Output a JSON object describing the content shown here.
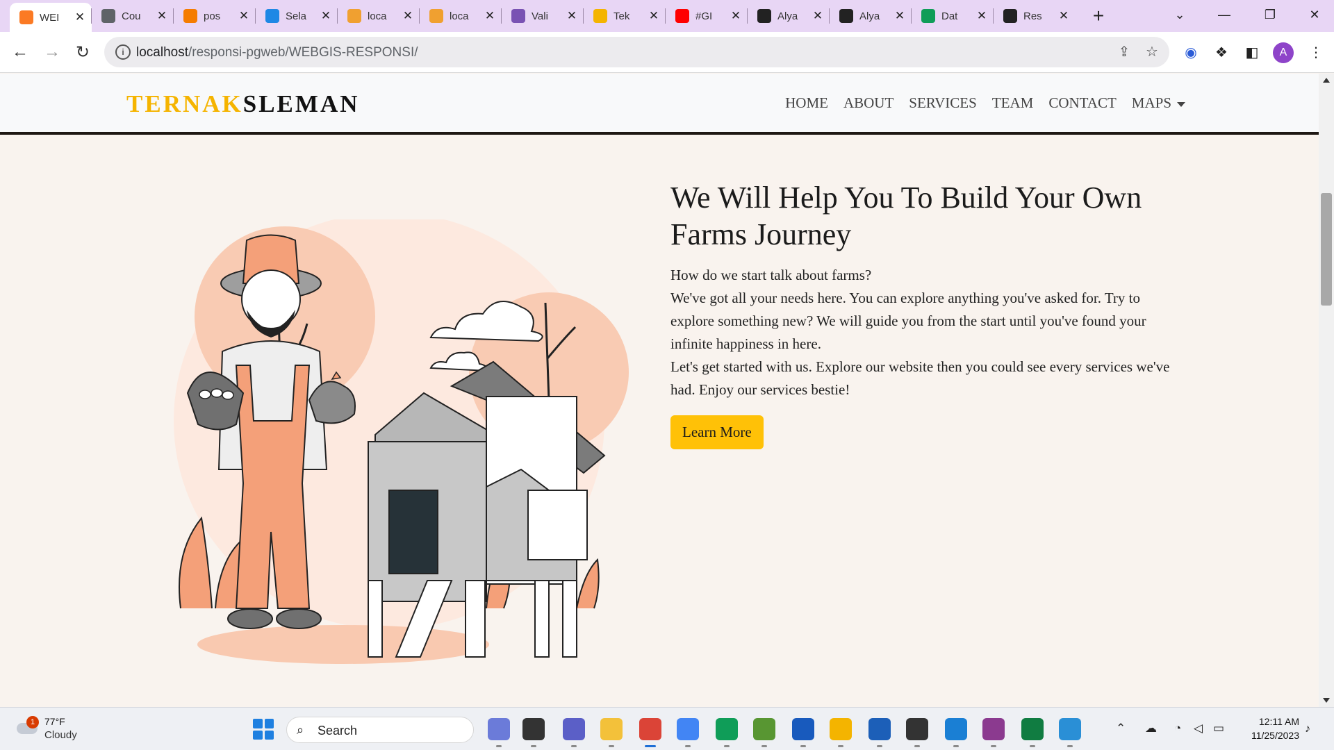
{
  "browser": {
    "tabs": [
      {
        "title": "WEI",
        "icon": "xampp-icon",
        "color": "#fb7a24"
      },
      {
        "title": "Cou",
        "icon": "globe-icon",
        "color": "#5f6368"
      },
      {
        "title": "pos",
        "icon": "postgis-icon",
        "color": "#f57c00"
      },
      {
        "title": "Sela",
        "icon": "snowflake-icon",
        "color": "#1e88e5"
      },
      {
        "title": "loca",
        "icon": "phpmyadmin-icon",
        "color": "#f0a030"
      },
      {
        "title": "loca",
        "icon": "phpmyadmin-icon",
        "color": "#f0a030"
      },
      {
        "title": "Vali",
        "icon": "bootstrap-icon",
        "color": "#7952b3"
      },
      {
        "title": "Tek",
        "icon": "slides-icon",
        "color": "#f4b400"
      },
      {
        "title": "#GI",
        "icon": "youtube-icon",
        "color": "#ff0000"
      },
      {
        "title": "Alya",
        "icon": "github-icon",
        "color": "#222222"
      },
      {
        "title": "Alya",
        "icon": "github-icon",
        "color": "#222222"
      },
      {
        "title": "Dat",
        "icon": "sheets-icon",
        "color": "#0f9d58"
      },
      {
        "title": "Res",
        "icon": "github-icon",
        "color": "#222222"
      }
    ],
    "url_host": "localhost",
    "url_path": "/responsi-pgweb/WEBGIS-RESPONSI/",
    "profile_initial": "A"
  },
  "site": {
    "brand_part1": "TERNAK",
    "brand_part2": "SLEMAN",
    "nav": [
      "HOME",
      "ABOUT",
      "SERVICES",
      "TEAM",
      "CONTACT",
      "MAPS"
    ],
    "hero_title": "We Will Help You To Build Your Own Farms Journey",
    "hero_paragraphs": [
      "How do we start talk about farms?",
      "We've got all your needs here. You can explore anything you've asked for. Try to explore something new? We will guide you from the start until you've found your infinite happiness in here.",
      "Let's get started with us. Explore our website then you could see every services we've had. Enjoy our services bestie!"
    ],
    "cta_label": "Learn More",
    "colors": {
      "accent": "#ffc107",
      "brand_yellow": "#f5b400",
      "illustration_orange": "#f4a079",
      "page_bg": "#f9f3ee"
    }
  },
  "taskbar": {
    "weather_temp": "77°F",
    "weather_cond": "Cloudy",
    "weather_badge": "1",
    "search_label": "Search",
    "time": "12:11 AM",
    "date": "11/25/2023"
  }
}
